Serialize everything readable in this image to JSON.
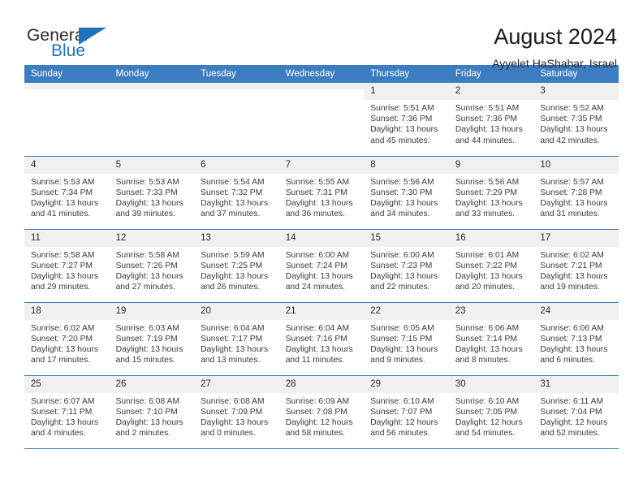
{
  "brand": {
    "name_top": "General",
    "name_bottom": "Blue",
    "accent_color": "#1f72bd"
  },
  "header": {
    "title": "August 2024",
    "subtitle": "Ayyelet HaShahar, Israel"
  },
  "calendar": {
    "header_color": "#3b7dc0",
    "weekdays": [
      "Sunday",
      "Monday",
      "Tuesday",
      "Wednesday",
      "Thursday",
      "Friday",
      "Saturday"
    ],
    "weeks": [
      [
        {
          "day": "",
          "sunrise": "",
          "sunset": "",
          "daylight": "",
          "blank": true
        },
        {
          "day": "",
          "sunrise": "",
          "sunset": "",
          "daylight": "",
          "blank": true
        },
        {
          "day": "",
          "sunrise": "",
          "sunset": "",
          "daylight": "",
          "blank": true
        },
        {
          "day": "",
          "sunrise": "",
          "sunset": "",
          "daylight": "",
          "blank": true
        },
        {
          "day": "1",
          "sunrise": "Sunrise: 5:51 AM",
          "sunset": "Sunset: 7:36 PM",
          "daylight": "Daylight: 13 hours and 45 minutes."
        },
        {
          "day": "2",
          "sunrise": "Sunrise: 5:51 AM",
          "sunset": "Sunset: 7:36 PM",
          "daylight": "Daylight: 13 hours and 44 minutes."
        },
        {
          "day": "3",
          "sunrise": "Sunrise: 5:52 AM",
          "sunset": "Sunset: 7:35 PM",
          "daylight": "Daylight: 13 hours and 42 minutes."
        }
      ],
      [
        {
          "day": "4",
          "sunrise": "Sunrise: 5:53 AM",
          "sunset": "Sunset: 7:34 PM",
          "daylight": "Daylight: 13 hours and 41 minutes."
        },
        {
          "day": "5",
          "sunrise": "Sunrise: 5:53 AM",
          "sunset": "Sunset: 7:33 PM",
          "daylight": "Daylight: 13 hours and 39 minutes."
        },
        {
          "day": "6",
          "sunrise": "Sunrise: 5:54 AM",
          "sunset": "Sunset: 7:32 PM",
          "daylight": "Daylight: 13 hours and 37 minutes."
        },
        {
          "day": "7",
          "sunrise": "Sunrise: 5:55 AM",
          "sunset": "Sunset: 7:31 PM",
          "daylight": "Daylight: 13 hours and 36 minutes."
        },
        {
          "day": "8",
          "sunrise": "Sunrise: 5:56 AM",
          "sunset": "Sunset: 7:30 PM",
          "daylight": "Daylight: 13 hours and 34 minutes."
        },
        {
          "day": "9",
          "sunrise": "Sunrise: 5:56 AM",
          "sunset": "Sunset: 7:29 PM",
          "daylight": "Daylight: 13 hours and 33 minutes."
        },
        {
          "day": "10",
          "sunrise": "Sunrise: 5:57 AM",
          "sunset": "Sunset: 7:28 PM",
          "daylight": "Daylight: 13 hours and 31 minutes."
        }
      ],
      [
        {
          "day": "11",
          "sunrise": "Sunrise: 5:58 AM",
          "sunset": "Sunset: 7:27 PM",
          "daylight": "Daylight: 13 hours and 29 minutes."
        },
        {
          "day": "12",
          "sunrise": "Sunrise: 5:58 AM",
          "sunset": "Sunset: 7:26 PM",
          "daylight": "Daylight: 13 hours and 27 minutes."
        },
        {
          "day": "13",
          "sunrise": "Sunrise: 5:59 AM",
          "sunset": "Sunset: 7:25 PM",
          "daylight": "Daylight: 13 hours and 26 minutes."
        },
        {
          "day": "14",
          "sunrise": "Sunrise: 6:00 AM",
          "sunset": "Sunset: 7:24 PM",
          "daylight": "Daylight: 13 hours and 24 minutes."
        },
        {
          "day": "15",
          "sunrise": "Sunrise: 6:00 AM",
          "sunset": "Sunset: 7:23 PM",
          "daylight": "Daylight: 13 hours and 22 minutes."
        },
        {
          "day": "16",
          "sunrise": "Sunrise: 6:01 AM",
          "sunset": "Sunset: 7:22 PM",
          "daylight": "Daylight: 13 hours and 20 minutes."
        },
        {
          "day": "17",
          "sunrise": "Sunrise: 6:02 AM",
          "sunset": "Sunset: 7:21 PM",
          "daylight": "Daylight: 13 hours and 19 minutes."
        }
      ],
      [
        {
          "day": "18",
          "sunrise": "Sunrise: 6:02 AM",
          "sunset": "Sunset: 7:20 PM",
          "daylight": "Daylight: 13 hours and 17 minutes."
        },
        {
          "day": "19",
          "sunrise": "Sunrise: 6:03 AM",
          "sunset": "Sunset: 7:19 PM",
          "daylight": "Daylight: 13 hours and 15 minutes."
        },
        {
          "day": "20",
          "sunrise": "Sunrise: 6:04 AM",
          "sunset": "Sunset: 7:17 PM",
          "daylight": "Daylight: 13 hours and 13 minutes."
        },
        {
          "day": "21",
          "sunrise": "Sunrise: 6:04 AM",
          "sunset": "Sunset: 7:16 PM",
          "daylight": "Daylight: 13 hours and 11 minutes."
        },
        {
          "day": "22",
          "sunrise": "Sunrise: 6:05 AM",
          "sunset": "Sunset: 7:15 PM",
          "daylight": "Daylight: 13 hours and 9 minutes."
        },
        {
          "day": "23",
          "sunrise": "Sunrise: 6:06 AM",
          "sunset": "Sunset: 7:14 PM",
          "daylight": "Daylight: 13 hours and 8 minutes."
        },
        {
          "day": "24",
          "sunrise": "Sunrise: 6:06 AM",
          "sunset": "Sunset: 7:13 PM",
          "daylight": "Daylight: 13 hours and 6 minutes."
        }
      ],
      [
        {
          "day": "25",
          "sunrise": "Sunrise: 6:07 AM",
          "sunset": "Sunset: 7:11 PM",
          "daylight": "Daylight: 13 hours and 4 minutes."
        },
        {
          "day": "26",
          "sunrise": "Sunrise: 6:08 AM",
          "sunset": "Sunset: 7:10 PM",
          "daylight": "Daylight: 13 hours and 2 minutes."
        },
        {
          "day": "27",
          "sunrise": "Sunrise: 6:08 AM",
          "sunset": "Sunset: 7:09 PM",
          "daylight": "Daylight: 13 hours and 0 minutes."
        },
        {
          "day": "28",
          "sunrise": "Sunrise: 6:09 AM",
          "sunset": "Sunset: 7:08 PM",
          "daylight": "Daylight: 12 hours and 58 minutes."
        },
        {
          "day": "29",
          "sunrise": "Sunrise: 6:10 AM",
          "sunset": "Sunset: 7:07 PM",
          "daylight": "Daylight: 12 hours and 56 minutes."
        },
        {
          "day": "30",
          "sunrise": "Sunrise: 6:10 AM",
          "sunset": "Sunset: 7:05 PM",
          "daylight": "Daylight: 12 hours and 54 minutes."
        },
        {
          "day": "31",
          "sunrise": "Sunrise: 6:11 AM",
          "sunset": "Sunset: 7:04 PM",
          "daylight": "Daylight: 12 hours and 52 minutes."
        }
      ]
    ]
  }
}
